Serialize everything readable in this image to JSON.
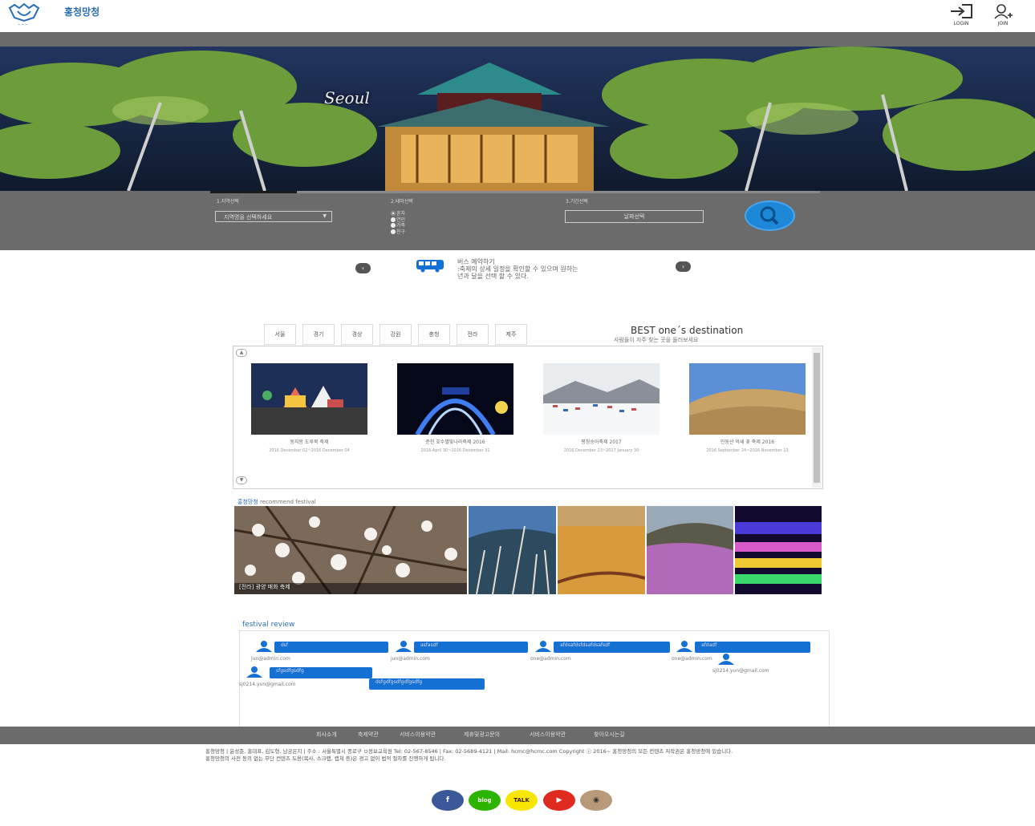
{
  "header": {
    "brand": "홍청망청",
    "login_label": "LOGIN",
    "join_label": "JOIN"
  },
  "hero": {
    "city": "Seoul"
  },
  "search": {
    "step1_label": "1.지역선택",
    "step2_label": "2.테마선택",
    "step3_label": "3.기간선택",
    "region_placeholder": "지역명을 선택하세요",
    "themes": [
      "혼자",
      "연인",
      "가족",
      "친구"
    ],
    "date_button": "날짜선택"
  },
  "bus": {
    "title": "버스 예약하기",
    "desc1": ":축제의 상세 일정을 확인할 수 있으며 원하는",
    "desc2": "년과 달을 선택 할 수 있다."
  },
  "regions": [
    "서울",
    "경기",
    "경상",
    "강원",
    "충청",
    "전라",
    "제주"
  ],
  "best": {
    "title": "BEST one´s destination",
    "subtitle": "사람들이 자주 찾는 곳을 둘러보세요"
  },
  "festivals": [
    {
      "title": "동지랑 도루묵 축제",
      "date": "2016 December 02~2016 December 04"
    },
    {
      "title": "춘천 호수별빛나라축제 2016",
      "date": "2016 April 30~2016 December 31"
    },
    {
      "title": "평창송어축제 2017",
      "date": "2016 December 23~2017 January 30"
    },
    {
      "title": "민둥산 억새 꽃 축제 2016",
      "date": "2016 September 24~2016 November 13"
    }
  ],
  "recommend": {
    "brand": "홍청망청",
    "label": "recommend festival",
    "caption": "[전라] 광양 매화 축제"
  },
  "reviews": {
    "title": "festival review",
    "items": [
      {
        "text": "dsf",
        "email": "jun@admin.com"
      },
      {
        "text": "asfasdf",
        "email": "jun@admin.com"
      },
      {
        "text": "afdsafdsfdsafdsafsdf",
        "email": "one@admin.com"
      },
      {
        "text": "afdadf",
        "email": "one@admin.com"
      },
      {
        "text": "",
        "email": "sj0214.yun@gmail.com"
      },
      {
        "text": "sfgsdfgsdfg",
        "email": "sj0214.yun@gmail.com"
      },
      {
        "text": "dsfgdfgsdfgdfgsdfg",
        "email": ""
      }
    ]
  },
  "footer": {
    "links": [
      "회사소개",
      "축제약관",
      "서비스이용약관",
      "제휴및광고문의",
      "서비스이용약관",
      "찾아오시는길"
    ],
    "info1": "홍청망청 | 윤성준, 홍대표, 김도형, 남궁은지 | 주소 : 서울특별시 종로구 ㅁ정보교육원 Tel: 02-567-8546 | Fax: 02-5689-4121 | Mail: hcmc@hcmc.com Copyright ⓒ 2016~ 홍청망청의 모든 컨텐츠 저작권은 홍청망청에 있습니다.",
    "info2": "홍청망청의 사전 동의 없는 무단 컨텐츠 도용(복사, 스크랩, 캡쳐 등)은 경고 없이 법적 절차를 진행하게 됩니다.",
    "sns": [
      "facebook-icon",
      "blog-icon",
      "kakaotalk-icon",
      "youtube-icon",
      "instagram-icon"
    ],
    "sns_labels": [
      "f",
      "blog",
      "TALK",
      "▶",
      "◉"
    ]
  }
}
